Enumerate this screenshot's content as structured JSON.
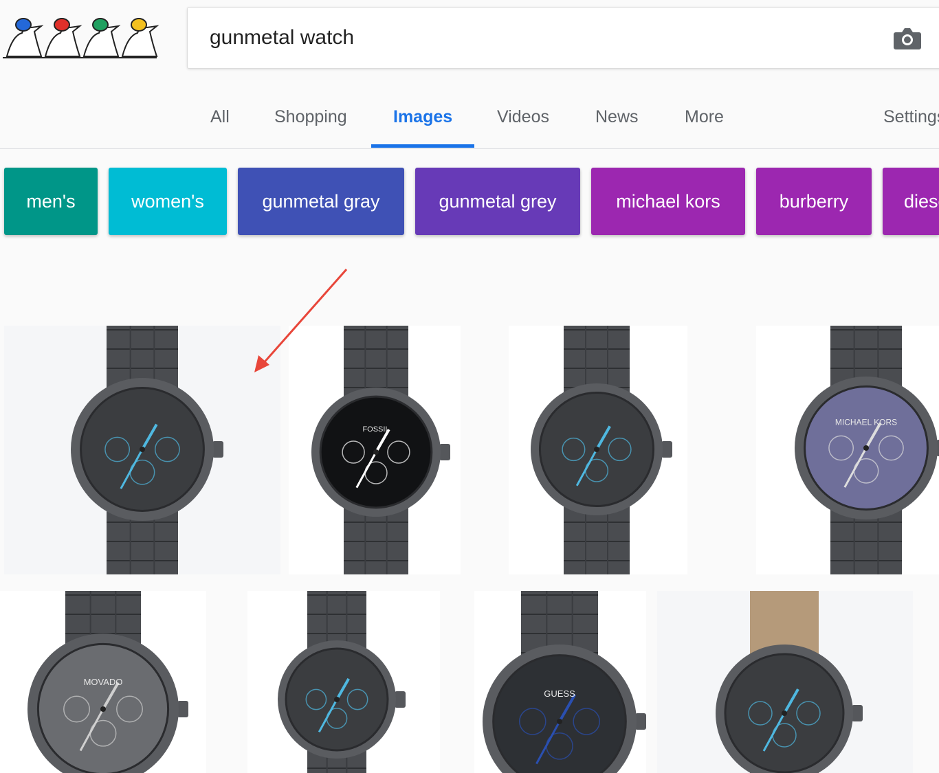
{
  "search": {
    "query": "gunmetal watch"
  },
  "tabs": [
    {
      "label": "All"
    },
    {
      "label": "Shopping"
    },
    {
      "label": "Images"
    },
    {
      "label": "Videos"
    },
    {
      "label": "News"
    },
    {
      "label": "More"
    },
    {
      "label": "Settings"
    }
  ],
  "active_tab": "Images",
  "chips": [
    {
      "label": "men's",
      "color": "#009688"
    },
    {
      "label": "women's",
      "color": "#00bcd4"
    },
    {
      "label": "gunmetal gray",
      "color": "#3f51b5"
    },
    {
      "label": "gunmetal grey",
      "color": "#673ab7"
    },
    {
      "label": "michael kors",
      "color": "#9c27b0"
    },
    {
      "label": "burberry",
      "color": "#9c27b0"
    },
    {
      "label": "diesel",
      "color": "#9c27b0"
    }
  ],
  "results": [
    {
      "brand": "",
      "dial": "#3b3d40",
      "accent": "#4fb8e0",
      "strap": "metal"
    },
    {
      "brand": "FOSSIL",
      "dial": "#111214",
      "accent": "#ffffff",
      "strap": "metal"
    },
    {
      "brand": "",
      "dial": "#3b3d40",
      "accent": "#4fb8e0",
      "strap": "metal"
    },
    {
      "brand": "MICHAEL KORS",
      "dial": "#6f6f9a",
      "accent": "#dddddd",
      "strap": "metal"
    },
    {
      "brand": "MOVADO",
      "dial": "#6a6c70",
      "accent": "#cfcfcf",
      "strap": "metal"
    },
    {
      "brand": "",
      "dial": "#3b3d40",
      "accent": "#4fb8e0",
      "strap": "metal"
    },
    {
      "brand": "GUESS",
      "dial": "#2d3034",
      "accent": "#2a4fb0",
      "strap": "metal"
    },
    {
      "brand": "",
      "dial": "#3b3d40",
      "accent": "#4fb8e0",
      "strap": "leather"
    }
  ],
  "colors": {
    "accent": "#1a73e8",
    "annotation_arrow": "#e8463a"
  }
}
